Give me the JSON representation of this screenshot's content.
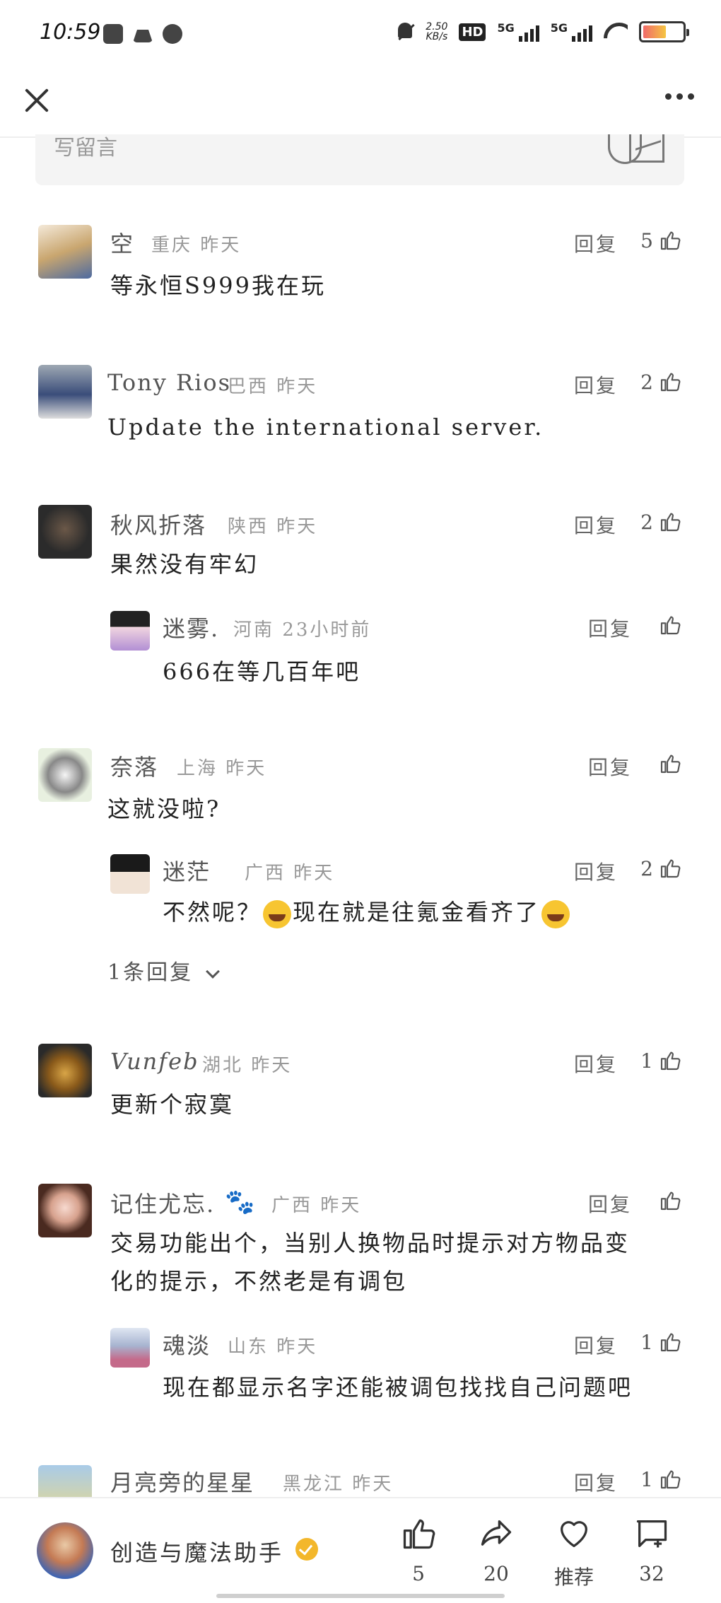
{
  "status_bar": {
    "time": "10:59",
    "net_speed": "2.50",
    "net_unit": "KB/s",
    "hd": "HD",
    "sim1": "5G",
    "sim2": "5G"
  },
  "comment_input": {
    "placeholder": "写留言"
  },
  "comments": [
    {
      "user": "空",
      "location": "重庆",
      "time": "昨天",
      "reply": "回复",
      "likes": "5",
      "text": "等永恒S999我在玩"
    },
    {
      "user": "Tony Rios",
      "location": "巴西",
      "time": "昨天",
      "reply": "回复",
      "likes": "2",
      "text": "Update the international server."
    },
    {
      "user": "秋风折落",
      "location": "陕西",
      "time": "昨天",
      "reply": "回复",
      "likes": "2",
      "text": "果然没有牢幻",
      "sub_reply": {
        "user": "迷雾.",
        "location": "河南",
        "time": "23小时前",
        "reply": "回复",
        "likes": "",
        "text": "666在等几百年吧"
      }
    },
    {
      "user": "奈落",
      "location": "上海",
      "time": "昨天",
      "reply": "回复",
      "likes": "",
      "text": "这就没啦?",
      "sub_reply": {
        "user": "迷茫",
        "location": "广西",
        "time": "昨天",
        "reply": "回复",
        "likes": "2",
        "text_before": "不然呢？",
        "text_middle": "现在就是往氪金看齐了"
      },
      "expand": "1条回复"
    },
    {
      "user": "Vunfeb",
      "location": "湖北",
      "time": "昨天",
      "reply": "回复",
      "likes": "1",
      "text": "更新个寂寞"
    },
    {
      "user": "记住尤忘.",
      "location": "广西",
      "time": "昨天",
      "reply": "回复",
      "likes": "",
      "text_line1": "交易功能出个，当别人换物品时提示对方物品变",
      "text_line2": "化的提示，不然老是有调包",
      "sub_reply": {
        "user": "魂淡",
        "location": "山东",
        "time": "昨天",
        "reply": "回复",
        "likes": "1",
        "text": "现在都显示名字还能被调包找找自己问题吧"
      }
    },
    {
      "user": "月亮旁的星星",
      "location": "黑龙江",
      "time": "昨天",
      "reply": "回复",
      "likes": "1"
    }
  ],
  "bottom_bar": {
    "account_name": "创造与魔法助手",
    "like_count": "5",
    "share_count": "20",
    "recommend_label": "推荐",
    "comment_count": "32"
  }
}
